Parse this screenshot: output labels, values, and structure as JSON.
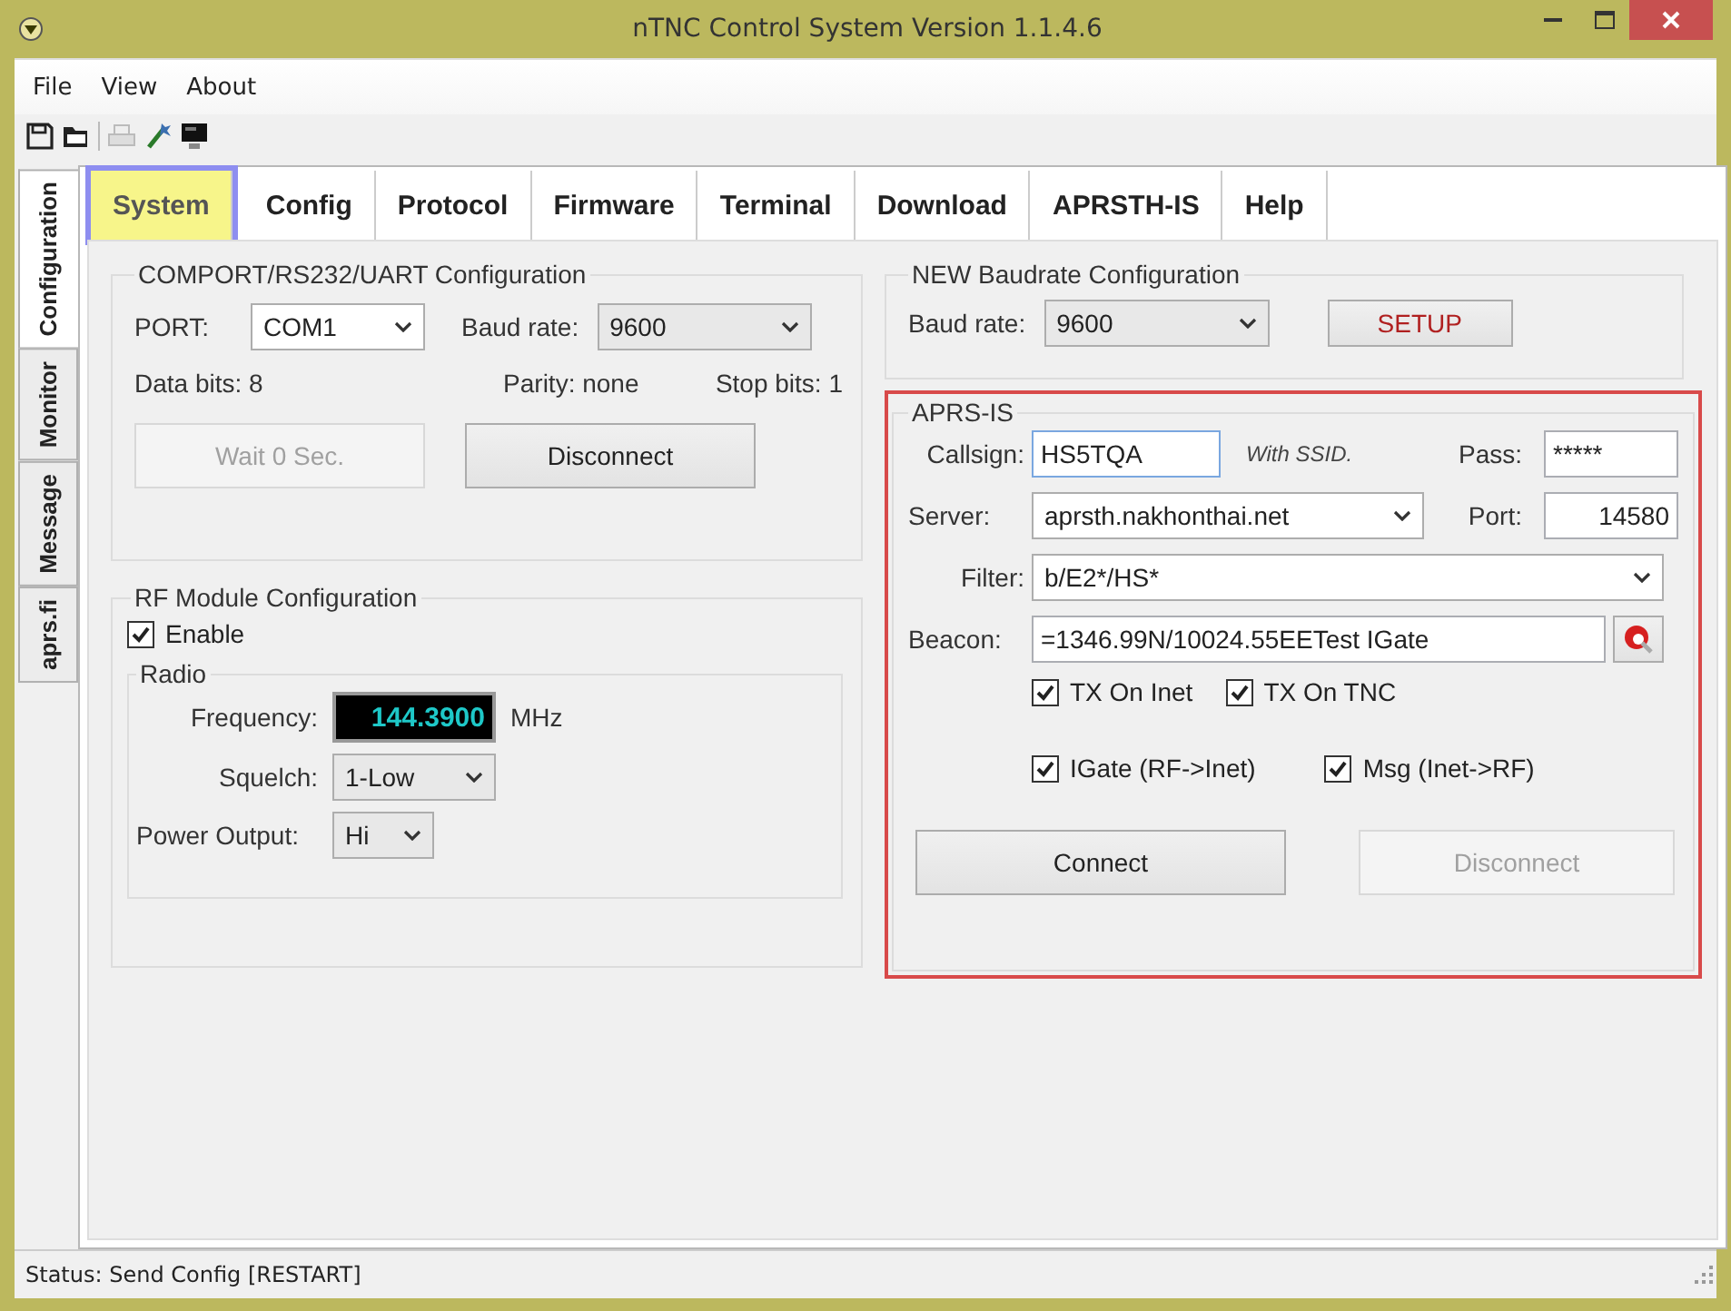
{
  "window": {
    "title": "nTNC Control System Version 1.1.4.6"
  },
  "menu": [
    "File",
    "View",
    "About"
  ],
  "side_tabs": [
    {
      "label": "Configuration",
      "selected": true
    },
    {
      "label": "Monitor",
      "selected": false
    },
    {
      "label": "Message",
      "selected": false
    },
    {
      "label": "aprs.fi",
      "selected": false
    }
  ],
  "tabs": [
    {
      "label": "System",
      "selected": true
    },
    {
      "label": "Config",
      "selected": false
    },
    {
      "label": "Protocol",
      "selected": false
    },
    {
      "label": "Firmware",
      "selected": false
    },
    {
      "label": "Terminal",
      "selected": false
    },
    {
      "label": "Download",
      "selected": false
    },
    {
      "label": "APRSTH-IS",
      "selected": false
    },
    {
      "label": "Help",
      "selected": false
    }
  ],
  "comport": {
    "title": "COMPORT/RS232/UART Configuration",
    "port_label": "PORT:",
    "port_value": "COM1",
    "baud_label": "Baud rate:",
    "baud_value": "9600",
    "data_bits": "Data bits: 8",
    "parity": "Parity: none",
    "stop_bits": "Stop bits: 1",
    "buttons": [
      {
        "label": "Wait 0 Sec.",
        "disabled": true
      },
      {
        "label": "Disconnect",
        "disabled": false
      }
    ]
  },
  "rf": {
    "title": "RF Module Configuration",
    "enable": {
      "label": "Enable",
      "checked": true
    },
    "radio": {
      "title": "Radio",
      "frequency_label": "Frequency:",
      "frequency_value": "144.3900",
      "frequency_unit": "MHz",
      "squelch_label": "Squelch:",
      "squelch_value": "1-Low",
      "power_label": "Power Output:",
      "power_value": "Hi"
    }
  },
  "baud_config": {
    "title": "NEW Baudrate Configuration",
    "baud_label": "Baud rate:",
    "baud_value": "9600",
    "setup_button": "SETUP"
  },
  "aprs": {
    "title": "APRS-IS",
    "callsign_label": "Callsign:",
    "callsign_value": "HS5TQA",
    "ssid_hint": "With SSID.",
    "pass_label": "Pass:",
    "pass_value": "*****",
    "server_label": "Server:",
    "server_value": "aprsth.nakhonthai.net",
    "port_label": "Port:",
    "port_value": "14580",
    "filter_label": "Filter:",
    "filter_value": "b/E2*/HS*",
    "beacon_label": "Beacon:",
    "beacon_value": "=1346.99N/10024.55EETest IGate",
    "options": [
      {
        "label": "TX On Inet",
        "checked": true
      },
      {
        "label": "TX On TNC",
        "checked": true
      },
      {
        "label": "IGate (RF->Inet)",
        "checked": true
      },
      {
        "label": "Msg (Inet->RF)",
        "checked": true
      }
    ],
    "buttons": [
      {
        "label": "Connect",
        "disabled": false
      },
      {
        "label": "Disconnect",
        "disabled": true
      }
    ]
  },
  "status": "Status: Send Config [RESTART]"
}
